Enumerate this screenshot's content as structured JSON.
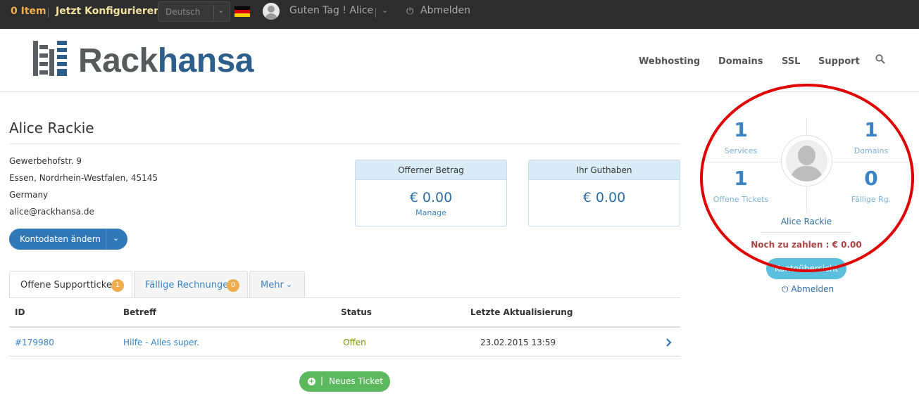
{
  "topbar": {
    "cart": "0 Item",
    "configure": "Jetzt Konfigurieren",
    "language": "Deutsch",
    "greeting": "Guten Tag ! Alice",
    "logout": "Abmelden",
    "logout_icon": "power-icon"
  },
  "brand": {
    "part1": "Rack",
    "part2": "hansa",
    "color_dark": "#595a5c",
    "color_blue": "#2e5e8b"
  },
  "nav": [
    "Webhosting",
    "Domains",
    "SSL",
    "Support"
  ],
  "profile": {
    "name": "Alice Rackie",
    "address": [
      "Gewerbehofstr. 9",
      "Essen, Nordrhein-Westfalen, 45145",
      "Germany",
      "alice@rackhansa.de"
    ],
    "edit_button": "Kontodaten ändern"
  },
  "stats": [
    {
      "title": "Offerner Betrag",
      "amount": "€ 0.00",
      "link": "Manage"
    },
    {
      "title": "Ihr Guthaben",
      "amount": "€ 0.00"
    }
  ],
  "tabs": [
    {
      "label": "Offene Supporttickets",
      "badge": "1"
    },
    {
      "label": "Fällige Rechnungen",
      "badge": "0"
    },
    {
      "label": "Mehr"
    }
  ],
  "table": {
    "headers": [
      "ID",
      "Betreff",
      "Status",
      "Letzte Aktualisierung"
    ],
    "rows": [
      {
        "id": "#179980",
        "subject": "Hilfe - Alles super.",
        "status": "Offen",
        "updated": "23.02.2015 13:59"
      }
    ]
  },
  "new_ticket": "Neues Ticket",
  "side": {
    "services": {
      "count": "1",
      "label": "Services"
    },
    "domains": {
      "count": "1",
      "label": "Domains"
    },
    "tickets": {
      "count": "1",
      "label": "Offene Tickets"
    },
    "invoices": {
      "count": "0",
      "label": "Fällige Rg."
    },
    "name": "Alice Rackie",
    "due": "Noch zu zahlen : € 0.00",
    "overview_button": "Kontoübersicht",
    "logout": "Abmelden"
  },
  "colors": {
    "accent": "#3178b7",
    "badge": "#f0ad4e",
    "success": "#5cb85c",
    "highlight_circle": "#e00000"
  }
}
